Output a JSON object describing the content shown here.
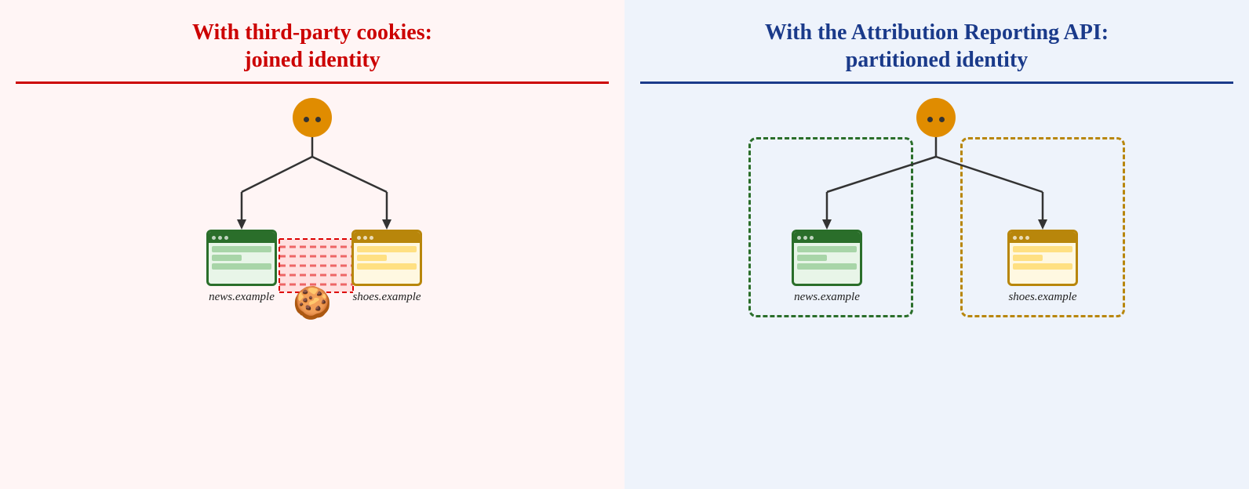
{
  "left_panel": {
    "title_line1": "With third-party cookies:",
    "title_line2": "joined identity",
    "browser_left_label": "news.example",
    "browser_right_label": "shoes.example"
  },
  "right_panel": {
    "title_line1": "With the Attribution Reporting API:",
    "title_line2": "partitioned identity",
    "browser_left_label": "news.example",
    "browser_right_label": "shoes.example"
  },
  "colors": {
    "left_title": "#cc0000",
    "left_divider": "#cc0000",
    "right_title": "#1a3a8a",
    "right_divider": "#1a3a8a",
    "left_bg": "#fff5f5",
    "right_bg": "#eef3fb"
  }
}
